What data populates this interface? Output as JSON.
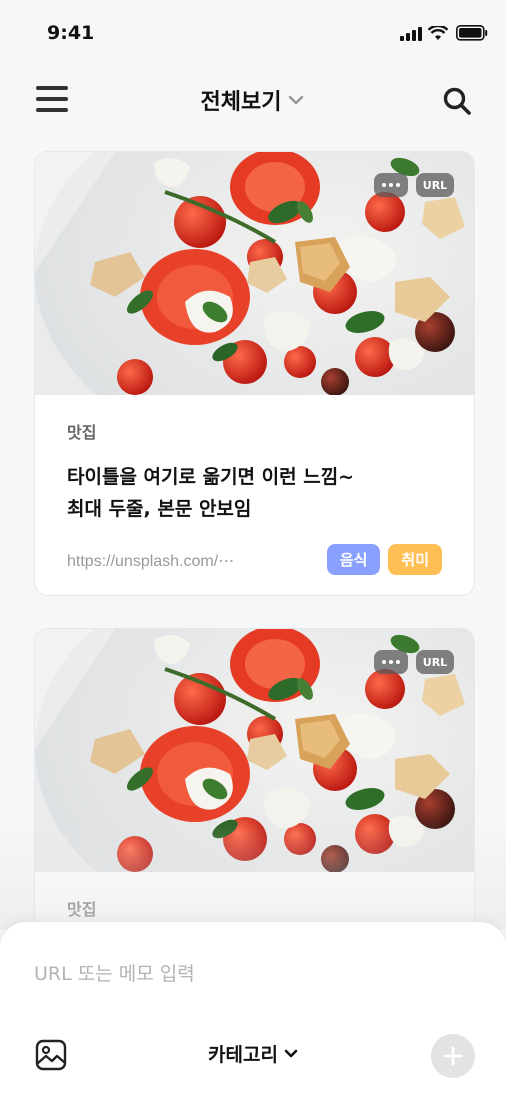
{
  "status_bar": {
    "time": "9:41",
    "icons": [
      "signal-icon",
      "wifi-icon",
      "battery-icon"
    ]
  },
  "header": {
    "title": "전체보기",
    "menu_icon": "hamburger-menu-icon",
    "search_icon": "search-icon",
    "title_dropdown_icon": "chevron-down-icon"
  },
  "cards": [
    {
      "image": "tomato-mozzarella-salad-photo",
      "more_label": "•••",
      "type_badge": "URL",
      "category": "맛집",
      "title_line1": "타이틀을 여기로 옮기면 이런 느낌~",
      "title_line2": "최대 두줄, 본문 안보임",
      "url": "https://unsplash.com/⋯",
      "tags": [
        {
          "label": "음식",
          "color": "#8aa0ff"
        },
        {
          "label": "취미",
          "color": "#ffbf55"
        }
      ]
    },
    {
      "image": "tomato-mozzarella-salad-photo",
      "more_label": "•••",
      "type_badge": "URL",
      "category": "맛집"
    }
  ],
  "composer": {
    "placeholder": "URL 또는 메모 입력",
    "category_label": "카테고리",
    "image_icon": "image-icon",
    "add_icon": "plus-icon"
  },
  "colors": {
    "background": "#f6f7f8",
    "tag_food": "#8aa0ff",
    "tag_hobby": "#ffbf55",
    "add_button": "#e2e3e5"
  }
}
